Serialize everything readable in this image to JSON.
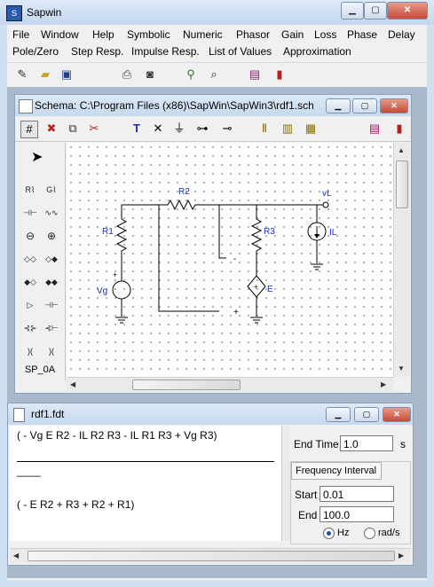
{
  "app": {
    "title": "Sapwin"
  },
  "menu": {
    "row1": [
      "File",
      "Window",
      "Help",
      "Symbolic",
      "Numeric",
      "Phasor",
      "Gain",
      "Loss",
      "Phase",
      "Delay"
    ],
    "row2": [
      "Pole/Zero",
      "Step Resp.",
      "Impulse Resp.",
      "List of Values",
      "Approximation"
    ]
  },
  "schema_window": {
    "title": "Schema: C:\\Program Files (x86)\\SapWin\\SapWin3\\rdf1.sch",
    "palette_label": "SP_0A",
    "palette_items": [
      "resistor",
      "conductance",
      "capacitor",
      "inductor",
      "voltage-source",
      "current-source",
      "vcvs",
      "vccs",
      "ccvs",
      "cccs",
      "opamp",
      "nullor",
      "npn",
      "njfet",
      "transformer",
      "coupled-inductors"
    ],
    "components": {
      "r1": "R1",
      "r2": "R2",
      "r3": "R3",
      "vg": "Vg",
      "e": "E",
      "il": "IL",
      "vl": "vL",
      "plus1": "+",
      "minus1": "-",
      "plus2": "+",
      "plus_vg": "+",
      "plus_e": "+"
    }
  },
  "result_window": {
    "title": "rdf1.fdt",
    "numerator": "( - Vg E R2 - IL R2 R3 - IL R1 R3 + Vg R3)",
    "fraction_mark": "____",
    "denominator": "( - E R2 + R3 + R2 + R1)",
    "end_time_label": "End Time:",
    "end_time_value": "1.0",
    "end_time_unit": "s",
    "freq_interval_label": "Frequency Interval",
    "start_label": "Start",
    "start_value": "0.01",
    "end_label": "End",
    "end_value": "100.0",
    "unit_hz": "Hz",
    "unit_rads": "rad/s",
    "selected_unit": "Hz"
  },
  "colors": {
    "label_blue": "#1a2fbf",
    "mdi_bg": "#a9b9cb",
    "title_gradient": "#dce9f7"
  }
}
